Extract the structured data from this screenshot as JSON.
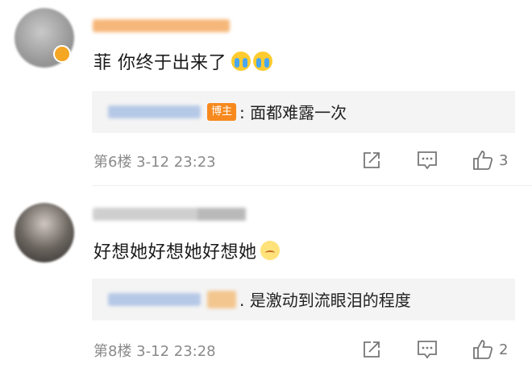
{
  "comments": [
    {
      "text": "菲 你终于出来了",
      "emojis": [
        "crying-emoji",
        "crying-emoji"
      ],
      "reply": {
        "badge": "博主",
        "text": ": 面都难露一次"
      },
      "meta": "第6楼  3-12 23:23",
      "likes": "3"
    },
    {
      "text": "好想她好想她好想她",
      "emojis": [
        "sad-emoji"
      ],
      "reply": {
        "badge": "",
        "text": ". 是激动到流眼泪的程度"
      },
      "meta": "第8楼  3-12 23:28",
      "likes": "2"
    }
  ],
  "icons": {
    "share": "share-icon",
    "comment": "comment-icon",
    "like": "thumbs-up-icon"
  },
  "colors": {
    "badge": "#f7891e",
    "meta_text": "#8a8a8a",
    "reply_bg": "#f4f4f4"
  }
}
